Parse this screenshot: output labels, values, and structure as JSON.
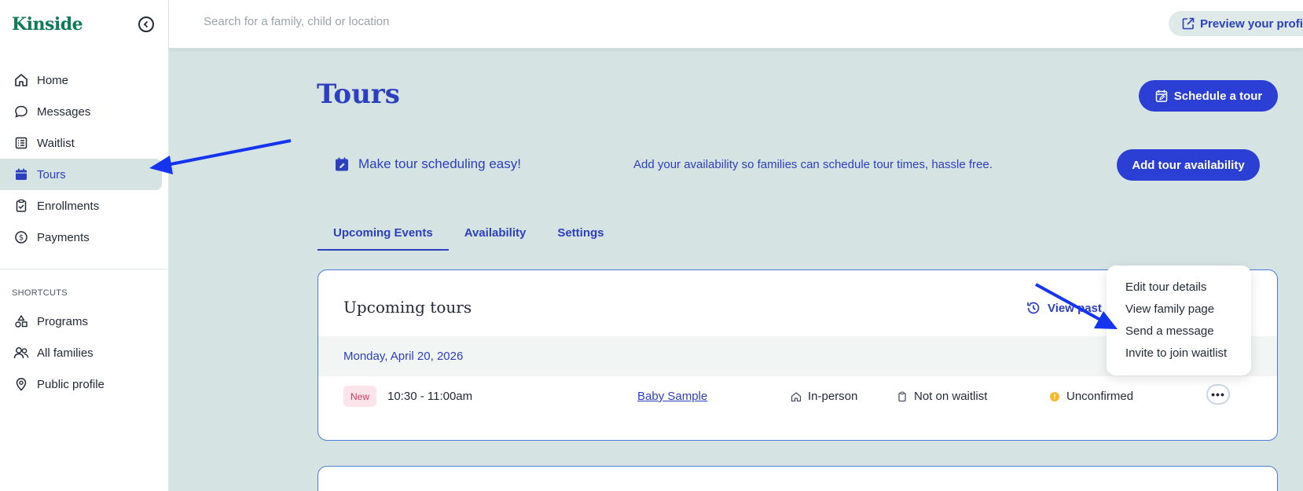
{
  "app": {
    "logo": "Kinside"
  },
  "sidebar": {
    "items": [
      {
        "label": "Home",
        "icon": "home-icon"
      },
      {
        "label": "Messages",
        "icon": "chat-icon"
      },
      {
        "label": "Waitlist",
        "icon": "list-icon"
      },
      {
        "label": "Tours",
        "icon": "calendar-icon",
        "active": true
      },
      {
        "label": "Enrollments",
        "icon": "clipboard-check-icon"
      },
      {
        "label": "Payments",
        "icon": "dollar-circle-icon"
      }
    ],
    "shortcuts_label": "SHORTCUTS",
    "shortcuts": [
      {
        "label": "Programs",
        "icon": "shapes-icon"
      },
      {
        "label": "All families",
        "icon": "users-icon"
      },
      {
        "label": "Public profile",
        "icon": "map-pin-icon"
      }
    ]
  },
  "topbar": {
    "search_placeholder": "Search for a family, child or location",
    "preview_label": "Preview your profil"
  },
  "main": {
    "title": "Tours",
    "schedule_label": "Schedule a tour",
    "promo_title": "Make tour scheduling easy!",
    "promo_text": "Add your availability so families can schedule tour times, hassle free.",
    "availability_button": "Add tour availability",
    "tabs": [
      {
        "label": "Upcoming Events",
        "active": true
      },
      {
        "label": "Availability"
      },
      {
        "label": "Settings"
      }
    ],
    "card": {
      "title": "Upcoming tours",
      "view_past": "View past",
      "date": "Monday, April 20, 2026",
      "row": {
        "badge": "New",
        "time": "10:30 - 11:00am",
        "child": "Baby Sample",
        "type": "In-person",
        "waitlist": "Not on waitlist",
        "status": "Unconfirmed",
        "more": "•••"
      }
    },
    "menu": [
      "Edit tour details",
      "View family page",
      "Send a message",
      "Invite to join waitlist"
    ]
  },
  "colors": {
    "brand_green": "#0f7a55",
    "accent_blue": "#2b3fd4",
    "page_bg": "#d5e3e3",
    "annotation_arrow": "#1434f0",
    "status_warning": "#f5b82e"
  }
}
